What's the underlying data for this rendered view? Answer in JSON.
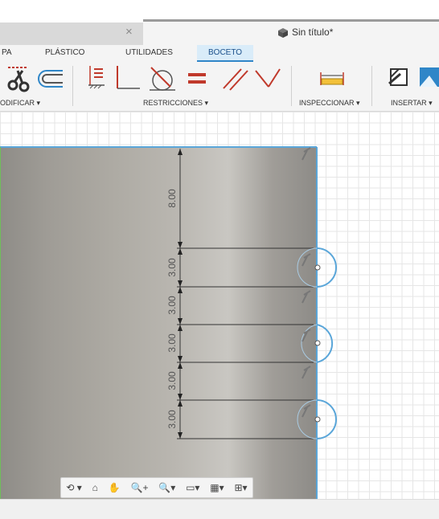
{
  "window": {
    "tab_close": "×",
    "doc_title": "Sin título*"
  },
  "ribbon": {
    "tabs": [
      "PA",
      "PLÁSTICO",
      "UTILIDADES",
      "BOCETO"
    ],
    "active_tab": "BOCETO",
    "groups": {
      "modify": "ODIFICAR ▾",
      "constraints": "RESTRICCIONES ▾",
      "inspect": "INSPECCIONAR ▾",
      "insert": "INSERTAR ▾"
    }
  },
  "sketch": {
    "dimensions": [
      "8.00",
      "3.00",
      "3.00",
      "3.00",
      "3.00",
      "3.00"
    ]
  },
  "navbar": {
    "orbit": "⟲ ▾",
    "look": "⌂",
    "pan": "✋",
    "zoom": "🔍+",
    "fit": "🔍▾",
    "display": "▭▾",
    "grid": "▦▾",
    "viewports": "⊞▾"
  },
  "colors": {
    "accent": "#2f86c8",
    "constraint_red": "#c0392b",
    "sketch_blue": "#5aa6d9"
  }
}
